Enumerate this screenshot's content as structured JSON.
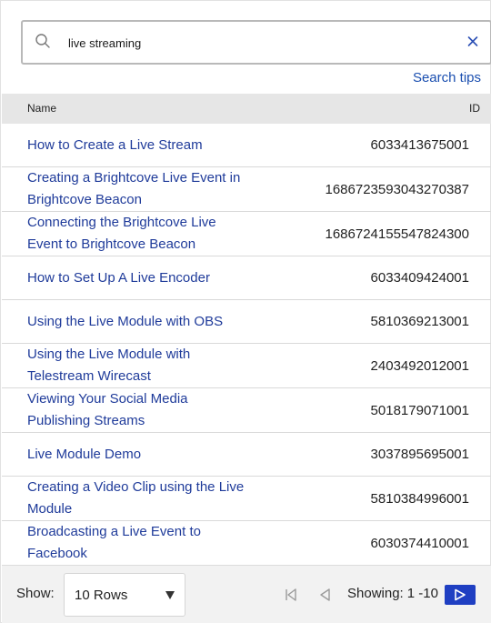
{
  "search": {
    "value": "live streaming",
    "tips_label": "Search tips"
  },
  "table": {
    "columns": {
      "name": "Name",
      "id": "ID"
    },
    "rows": [
      {
        "name": "How to Create a Live Stream",
        "id": "6033413675001"
      },
      {
        "name": "Creating a Brightcove Live Event in Brightcove Beacon",
        "id": "1686723593043270387"
      },
      {
        "name": "Connecting the Brightcove Live Event to Brightcove Beacon",
        "id": "1686724155547824300"
      },
      {
        "name": "How to Set Up A Live Encoder",
        "id": "6033409424001"
      },
      {
        "name": "Using the Live Module with OBS",
        "id": "5810369213001"
      },
      {
        "name": "Using the Live Module with Telestream Wirecast",
        "id": "2403492012001"
      },
      {
        "name": "Viewing Your Social Media Publishing Streams",
        "id": "5018179071001"
      },
      {
        "name": "Live Module Demo",
        "id": "3037895695001"
      },
      {
        "name": "Creating a Video Clip using the Live Module",
        "id": "5810384996001"
      },
      {
        "name": "Broadcasting a Live Event to Facebook",
        "id": "6030374410001"
      }
    ]
  },
  "footer": {
    "show_label": "Show:",
    "rows_selected": "10 Rows",
    "showing_label": "Showing:",
    "showing_range": "1 -10"
  },
  "colors": {
    "link": "#1f3b9a",
    "accent": "#1f3fc2",
    "header_bg": "#e6e6e6"
  },
  "icons": {
    "search": "search-icon",
    "clear": "close-icon",
    "caret": "caret-down-icon",
    "first": "first-page-icon",
    "prev": "previous-page-icon",
    "next": "next-page-icon"
  }
}
